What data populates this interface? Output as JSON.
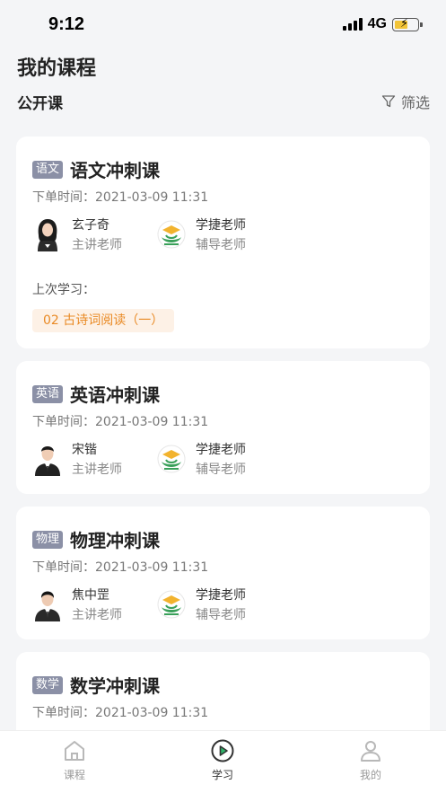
{
  "status": {
    "time": "9:12",
    "network": "4G"
  },
  "page": {
    "title": "我的课程"
  },
  "section": {
    "title": "公开课",
    "filter_label": "筛选"
  },
  "courses": [
    {
      "subject": "语文",
      "name": "语文冲刺课",
      "order_time": "下单时间：2021-03-09 11:31",
      "lecturer": {
        "name": "玄子奇",
        "role": "主讲老师"
      },
      "tutor": {
        "name": "学捷老师",
        "role": "辅导老师"
      },
      "last_study_label": "上次学习：",
      "last_study_item": "02 古诗词阅读（一）"
    },
    {
      "subject": "英语",
      "name": "英语冲刺课",
      "order_time": "下单时间：2021-03-09 11:31",
      "lecturer": {
        "name": "宋锴",
        "role": "主讲老师"
      },
      "tutor": {
        "name": "学捷老师",
        "role": "辅导老师"
      }
    },
    {
      "subject": "物理",
      "name": "物理冲刺课",
      "order_time": "下单时间：2021-03-09 11:31",
      "lecturer": {
        "name": "焦中罡",
        "role": "主讲老师"
      },
      "tutor": {
        "name": "学捷老师",
        "role": "辅导老师"
      }
    },
    {
      "subject": "数学",
      "name": "数学冲刺课",
      "order_time": "下单时间：2021-03-09 11:31"
    }
  ],
  "tabbar": [
    {
      "label": "课程",
      "icon": "home-icon"
    },
    {
      "label": "学习",
      "icon": "play-circle-icon",
      "active": true
    },
    {
      "label": "我的",
      "icon": "user-icon"
    }
  ],
  "colors": {
    "accent": "#e98a25",
    "tag_bg": "#8b90a6",
    "background": "#f4f5f7"
  }
}
